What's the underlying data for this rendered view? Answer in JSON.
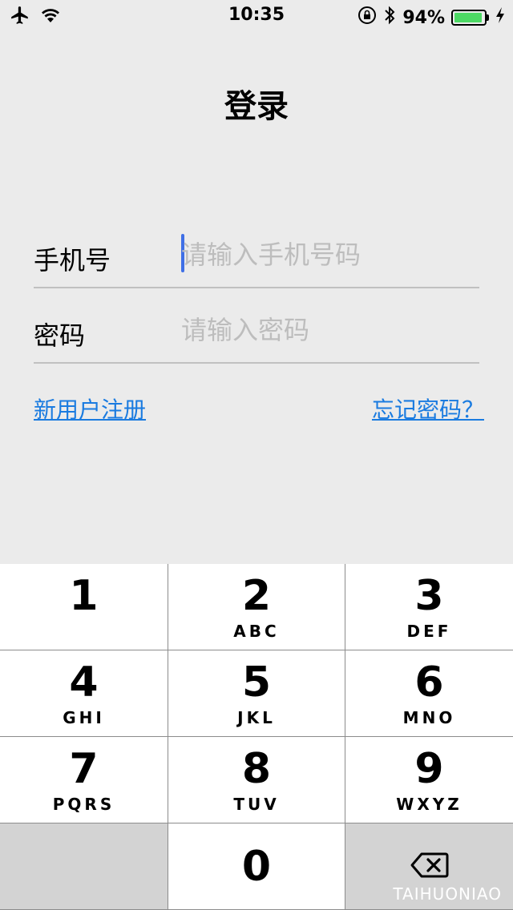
{
  "status_bar": {
    "time": "10:35",
    "battery_percent": "94%",
    "battery_level": 0.94,
    "battery_color": "#4cd964"
  },
  "title": "登录",
  "form": {
    "phone": {
      "label": "手机号",
      "placeholder": "请输入手机号码",
      "value": ""
    },
    "password": {
      "label": "密码",
      "placeholder": "请输入密码",
      "value": ""
    }
  },
  "links": {
    "register": "新用户注册",
    "forgot": "忘记密码？"
  },
  "keypad": {
    "keys": [
      {
        "digit": "1",
        "letters": ""
      },
      {
        "digit": "2",
        "letters": "ABC"
      },
      {
        "digit": "3",
        "letters": "DEF"
      },
      {
        "digit": "4",
        "letters": "GHI"
      },
      {
        "digit": "5",
        "letters": "JKL"
      },
      {
        "digit": "6",
        "letters": "MNO"
      },
      {
        "digit": "7",
        "letters": "PQRS"
      },
      {
        "digit": "8",
        "letters": "TUV"
      },
      {
        "digit": "9",
        "letters": "WXYZ"
      }
    ],
    "zero": "0"
  },
  "watermark": "TAIHUONIAO",
  "colors": {
    "accent": "#1a7be0",
    "caret": "#3f6fe6",
    "background": "#ebebeb"
  }
}
